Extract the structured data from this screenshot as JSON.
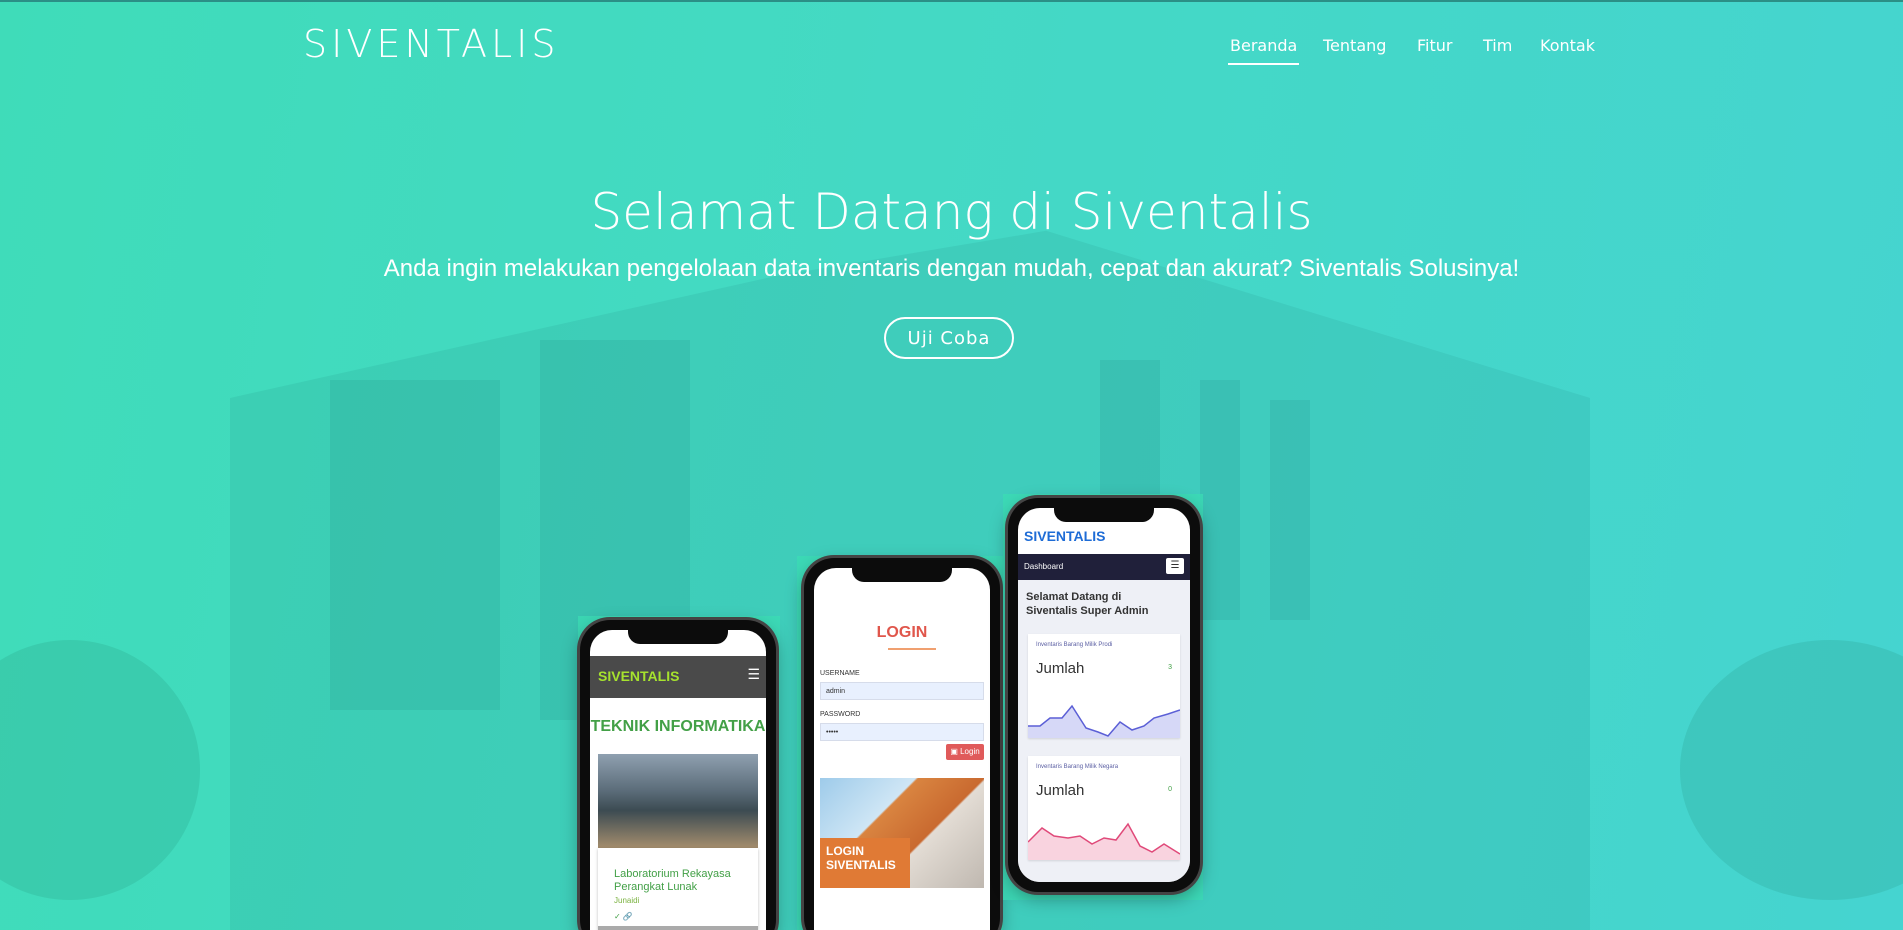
{
  "brand": "SIVENTALIS",
  "nav": {
    "items": [
      {
        "label": "Beranda",
        "active": true
      },
      {
        "label": "Tentang",
        "active": false
      },
      {
        "label": "Fitur",
        "active": false
      },
      {
        "label": "Tim",
        "active": false
      },
      {
        "label": "Kontak",
        "active": false
      }
    ]
  },
  "hero": {
    "title": "Selamat Datang di Siventalis",
    "subtitle": "Anda ingin melakukan pengelolaan data inventaris dengan mudah, cepat dan akurat? Siventalis Solusinya!",
    "cta_label": "Uji Coba"
  },
  "phone_left": {
    "brand": "SIVENTALIS",
    "menu_icon": "hamburger-icon",
    "section_title": "TEKNIK INFORMATIKA",
    "card_caption": "Laboratorium Rekayasa Perangkat Lunak",
    "card_author": "Junaidi",
    "card_icons": "✓ 🔗"
  },
  "phone_middle": {
    "title": "LOGIN",
    "username_label": "USERNAME",
    "username_value": "admin",
    "password_label": "PASSWORD",
    "password_value": "•••••",
    "login_button": "Login",
    "banner_caption": "LOGIN SIVENTALIS"
  },
  "phone_right": {
    "brand": "SIVENTALIS",
    "nav_label": "Dashboard",
    "menu_icon": "hamburger-icon",
    "welcome": "Selamat Datang di Siventalis Super Admin",
    "cards": [
      {
        "title": "Inventaris Barang Milik Prodi",
        "label": "Jumlah",
        "count": "3",
        "color": "#5b5fd6",
        "fill": "#d6d8f7"
      },
      {
        "title": "Inventaris Barang Milik Negara",
        "label": "Jumlah",
        "count": "0",
        "color": "#e04a7a",
        "fill": "#f9d3df"
      }
    ]
  },
  "colors": {
    "gradient_start": "#3fdcb9",
    "gradient_end": "#45d4d0",
    "text": "#ffffff"
  }
}
